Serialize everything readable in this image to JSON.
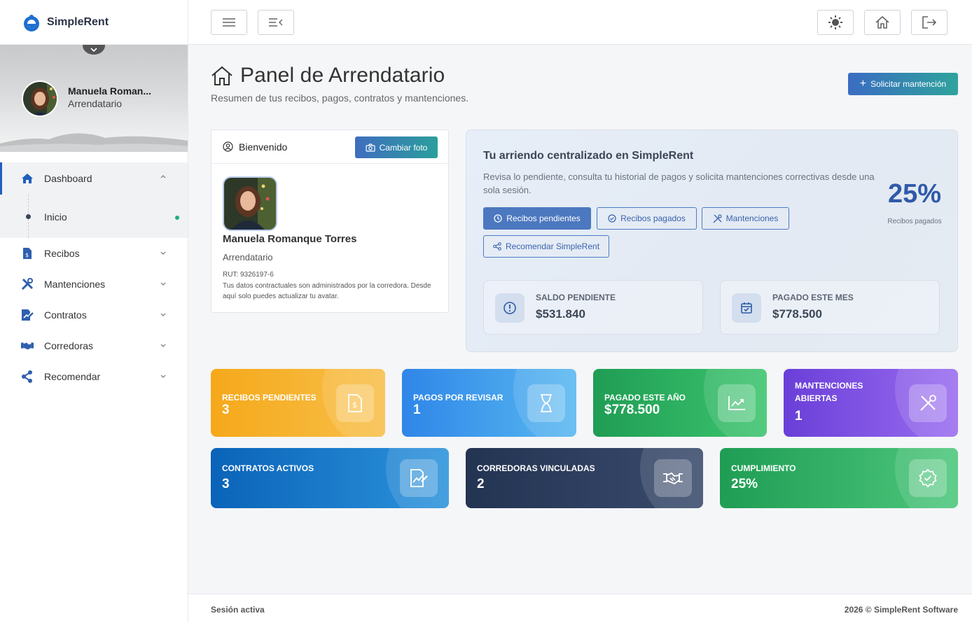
{
  "brand": {
    "name": "SimpleRent"
  },
  "profile": {
    "name": "Manuela Roman...",
    "role": "Arrendatario"
  },
  "nav": {
    "dashboard": "Dashboard",
    "inicio": "Inicio",
    "recibos": "Recibos",
    "mantenciones": "Mantenciones",
    "contratos": "Contratos",
    "corredoras": "Corredoras",
    "recomendar": "Recomendar"
  },
  "page": {
    "title": "Panel de Arrendatario",
    "subtitle": "Resumen de tus recibos, pagos, contratos y mantenciones.",
    "request_button": "Solicitar mantención"
  },
  "welcome": {
    "header": "Bienvenido",
    "photo_button": "Cambiar foto",
    "name": "Manuela Romanque Torres",
    "role": "Arrendatario",
    "rut": "RUT: 9326197-6",
    "note": "Tus datos contractuales son administrados por la corredora. Desde aquí solo puedes actualizar tu avatar."
  },
  "hero": {
    "title": "Tu arriendo centralizado en SimpleRent",
    "description": "Revisa lo pendiente, consulta tu historial de pagos y solicita mantenciones correctivas desde una sola sesión.",
    "buttons": {
      "pending": "Recibos pendientes",
      "paid": "Recibos pagados",
      "maint": "Mantenciones",
      "recommend": "Recomendar SimpleRent"
    },
    "percent": "25%",
    "percent_label": "Recibos pagados",
    "saldo_label": "SALDO PENDIENTE",
    "saldo_value": "$531.840",
    "pagado_label": "PAGADO ESTE MES",
    "pagado_value": "$778.500"
  },
  "stats": {
    "recibos_label": "RECIBOS PENDIENTES",
    "recibos_value": "3",
    "pagos_label": "PAGOS POR REVISAR",
    "pagos_value": "1",
    "anio_label": "PAGADO ESTE AÑO",
    "anio_value": "$778.500",
    "mant_label": "MANTENCIONES ABIERTAS",
    "mant_value": "1",
    "contratos_label": "CONTRATOS ACTIVOS",
    "contratos_value": "3",
    "corredoras_label": "CORREDORAS VINCULADAS",
    "corredoras_value": "2",
    "cumpl_label": "CUMPLIMIENTO",
    "cumpl_value": "25%"
  },
  "footer": {
    "left": "Sesión activa",
    "right": "2026 © SimpleRent Software"
  },
  "colors": {
    "accent": "#1f5fbf",
    "orange": "#f5a623",
    "blue": "#3b8ef0",
    "green": "#2daa5f",
    "purple": "#7c4fe0",
    "navy": "#2b3a58"
  }
}
